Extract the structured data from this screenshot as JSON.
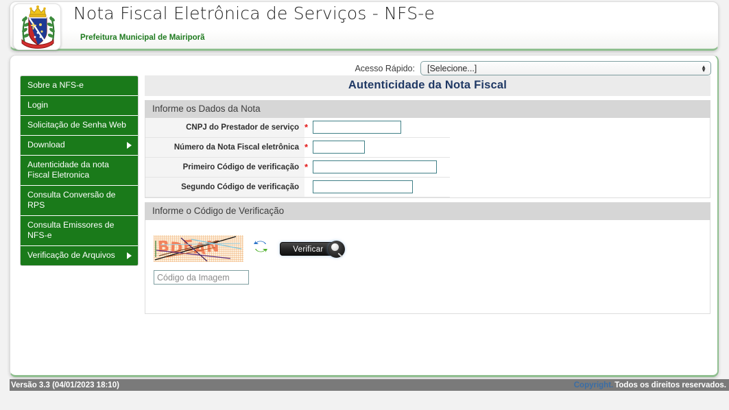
{
  "header": {
    "title": "Nota Fiscal Eletrônica de Serviços - NFS-e",
    "subtitle": "Prefeitura Municipal de Mairiporã",
    "crest_icon": "coat-of-arms-icon"
  },
  "quick_access": {
    "label": "Acesso Rápido:",
    "selected": "[Selecione...]",
    "options": [
      "[Selecione...]"
    ]
  },
  "sidebar": {
    "items": [
      {
        "label": "Sobre a NFS-e",
        "has_submenu": false
      },
      {
        "label": "Login",
        "has_submenu": false
      },
      {
        "label": "Solicitação de Senha Web",
        "has_submenu": false
      },
      {
        "label": "Download",
        "has_submenu": true
      },
      {
        "label": "Autenticidade da nota Fiscal Eletronica",
        "has_submenu": false
      },
      {
        "label": "Consulta Conversão de RPS",
        "has_submenu": false
      },
      {
        "label": "Consulta Emissores de NFS-e",
        "has_submenu": false
      },
      {
        "label": "Verificação de Arquivos",
        "has_submenu": true
      }
    ]
  },
  "main": {
    "page_title": "Autenticidade da Nota Fiscal",
    "section_data": {
      "title": "Informe os Dados da Nota",
      "fields": [
        {
          "label": "CNPJ do Prestador de serviço",
          "required": "*",
          "value": "",
          "width_class": "w-cnpj"
        },
        {
          "label": "Número da Nota Fiscal eletrônica",
          "required": "*",
          "value": "",
          "width_class": "w-num"
        },
        {
          "label": "Primeiro Código de verificação",
          "required": "*",
          "value": "",
          "width_class": "w-cod1"
        },
        {
          "label": "Segundo Código de verificação",
          "required": "",
          "value": "",
          "width_class": "w-cod2"
        }
      ]
    },
    "section_captcha": {
      "title": "Informe o Código de Verificação",
      "captcha_text": "BDEAN",
      "refresh_icon": "refresh-icon",
      "verify_button": "Verificar",
      "verify_icon": "magnifier-icon",
      "input_placeholder": "Código da Imagem",
      "input_value": ""
    }
  },
  "footer": {
    "version": "Versão 3.3 (04/01/2023 18:10)",
    "copyright_link": "Copyright.",
    "rights": "Todos os direitos reservados."
  },
  "colors": {
    "menu_green": "#1a7a1a",
    "title_navy": "#1f3864",
    "required_red": "#e11717",
    "footer_gray": "#7a7a7a",
    "accent_border_green": "#8fbf8f",
    "input_border_teal": "#3f7f86"
  }
}
